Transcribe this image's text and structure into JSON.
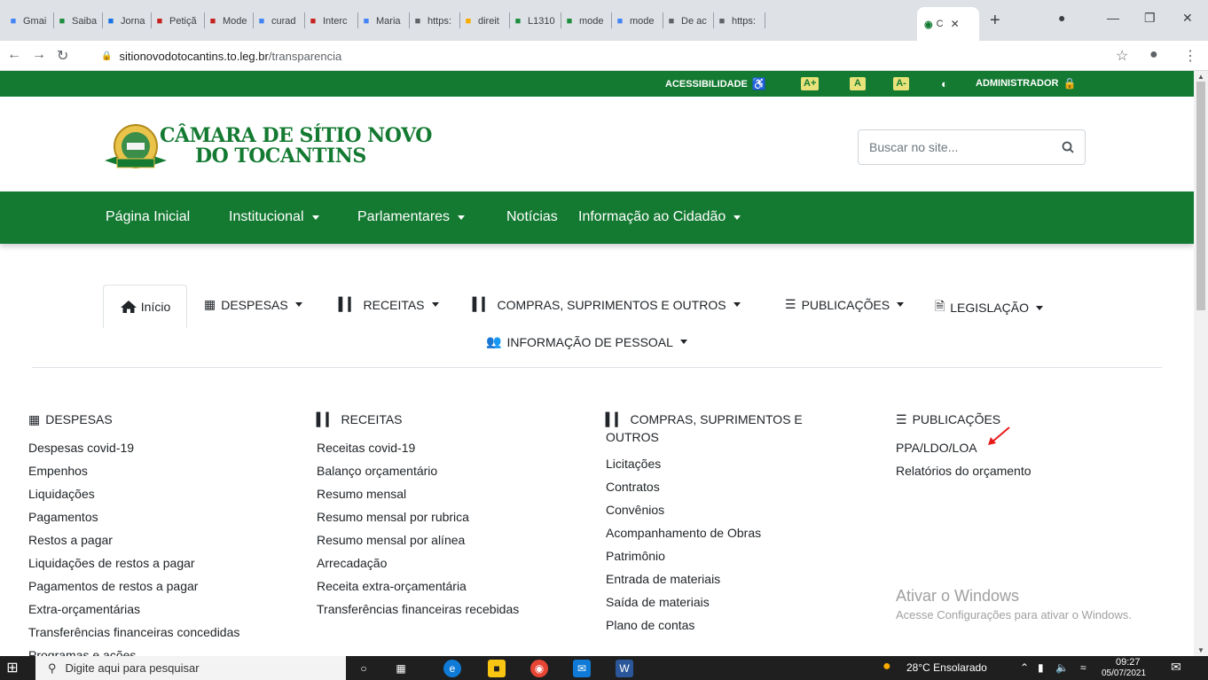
{
  "browser": {
    "tabs": [
      {
        "label": "Gmai",
        "icon": "google-icon",
        "color": "#4285f4"
      },
      {
        "label": "Saiba",
        "icon": "drive-icon",
        "color": "#1e8e3e"
      },
      {
        "label": "Jorna",
        "icon": "news-icon",
        "color": "#1a73e8"
      },
      {
        "label": "Petiçã",
        "icon": "jus-icon",
        "color": "#c5221f"
      },
      {
        "label": "Mode",
        "icon": "diamond-icon",
        "color": "#c5221f"
      },
      {
        "label": "curad",
        "icon": "google-icon",
        "color": "#4285f4"
      },
      {
        "label": "Interc",
        "icon": "mg-icon",
        "color": "#c5221f"
      },
      {
        "label": "Maria",
        "icon": "google-icon",
        "color": "#4285f4"
      },
      {
        "label": "https:",
        "icon": "doc-icon",
        "color": "#5f6368"
      },
      {
        "label": "direit",
        "icon": "folder-icon",
        "color": "#f9ab00"
      },
      {
        "label": "L1310",
        "icon": "play-icon",
        "color": "#1e8e3e"
      },
      {
        "label": "mode",
        "icon": "drive-icon",
        "color": "#1e8e3e"
      },
      {
        "label": "mode",
        "icon": "google-icon",
        "color": "#4285f4"
      },
      {
        "label": "De ac",
        "icon": "globe-icon",
        "color": "#5f6368"
      },
      {
        "label": "https:",
        "icon": "globe-icon",
        "color": "#5f6368"
      }
    ],
    "active_tab_label": "C",
    "url_domain": "sitionovodotocantins.to.leg.br",
    "url_path": "/transparencia"
  },
  "site": {
    "colors": {
      "green": "#147a32",
      "yellow": "#e9e27a"
    },
    "topbar": {
      "accessibility": "ACESSIBILIDADE",
      "font_increase": "A+",
      "font_normal": "A",
      "font_decrease": "A-",
      "admin": "ADMINISTRADOR"
    },
    "logo": {
      "line1": "CÂMARA DE SÍTIO NOVO",
      "line2": "DO TOCANTINS"
    },
    "search": {
      "placeholder": "Buscar no site..."
    },
    "mainnav": {
      "home": "Página Inicial",
      "institucional": "Institucional",
      "parlamentares": "Parlamentares",
      "noticias": "Notícias",
      "cidadao": "Informação ao Cidadão"
    },
    "subnav": {
      "inicio": "Início",
      "despesas": "DESPESAS",
      "receitas": "RECEITAS",
      "compras": "COMPRAS, SUPRIMENTOS E OUTROS",
      "publicacoes": "PUBLICAÇÕES",
      "legislacao": "LEGISLAÇÃO",
      "pessoal": "INFORMAÇÃO DE PESSOAL"
    },
    "columns": {
      "despesas": {
        "title": "DESPESAS",
        "items": [
          "Despesas covid-19",
          "Empenhos",
          "Liquidações",
          "Pagamentos",
          "Restos a pagar",
          "Liquidações de restos a pagar",
          "Pagamentos de restos a pagar",
          "Extra-orçamentárias",
          "Transferências financeiras concedidas",
          "Programas e ações"
        ]
      },
      "receitas": {
        "title": "RECEITAS",
        "items": [
          "Receitas covid-19",
          "Balanço orçamentário",
          "Resumo mensal",
          "Resumo mensal por rubrica",
          "Resumo mensal por alínea",
          "Arrecadação",
          "Receita extra-orçamentária",
          "Transferências financeiras recebidas"
        ]
      },
      "compras": {
        "title_line1": "COMPRAS, SUPRIMENTOS E",
        "title_line2": "OUTROS",
        "items": [
          "Licitações",
          "Contratos",
          "Convênios",
          "Acompanhamento de Obras",
          "Patrimônio",
          "Entrada de materiais",
          "Saída de materiais",
          "Plano de contas"
        ]
      },
      "publicacoes": {
        "title": "PUBLICAÇÕES",
        "items": [
          "PPA/LDO/LOA",
          "Relatórios do orçamento"
        ]
      }
    }
  },
  "windows": {
    "watermark_title": "Ativar o Windows",
    "watermark_sub": "Acesse Configurações para ativar o Windows.",
    "search_placeholder": "Digite aqui para pesquisar",
    "weather": "28°C  Ensolarado",
    "time": "09:27",
    "date": "05/07/2021"
  }
}
